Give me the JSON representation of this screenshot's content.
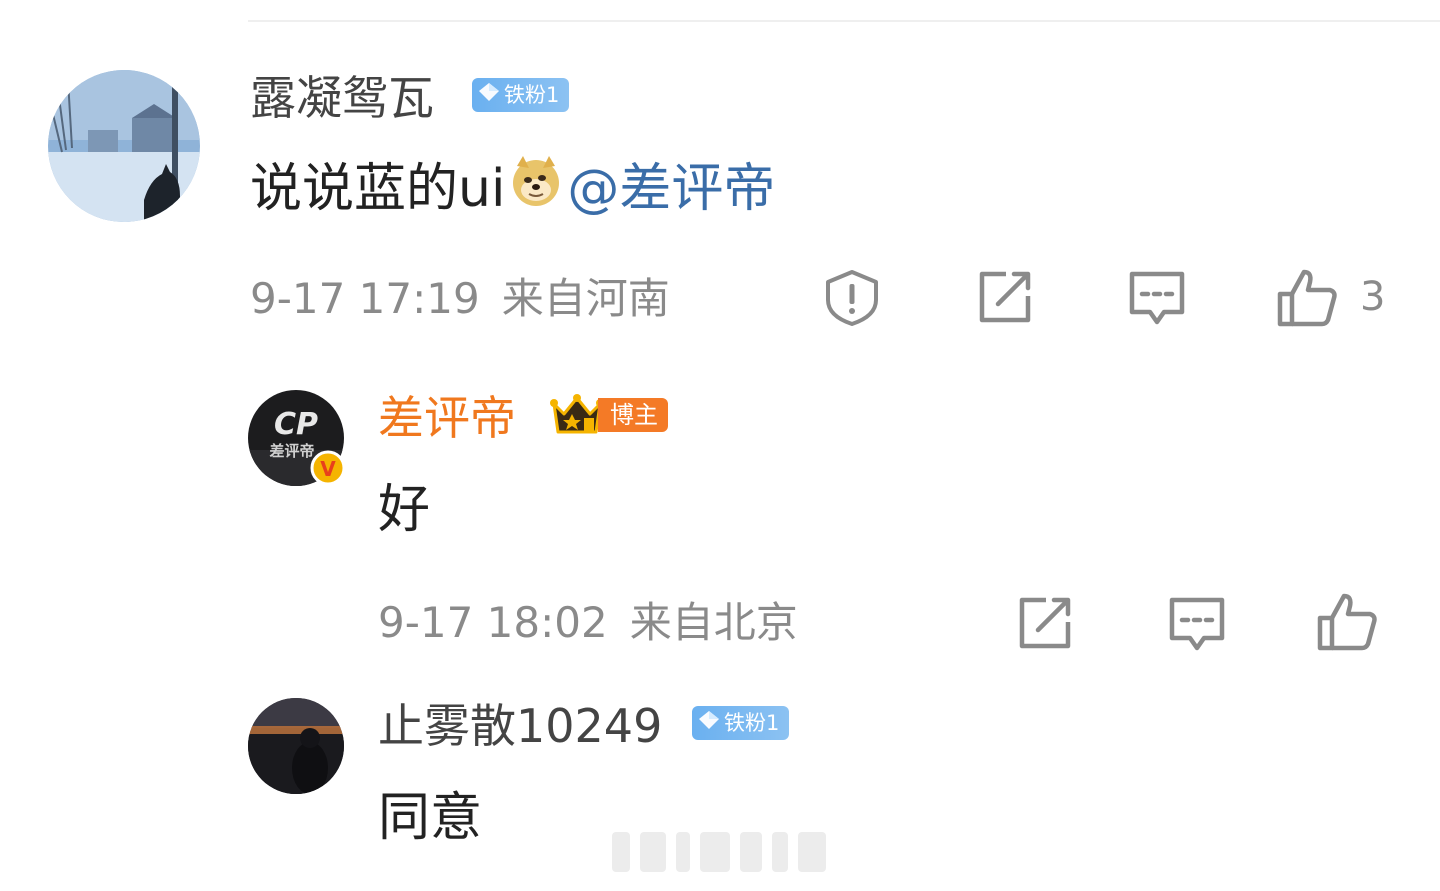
{
  "comments": [
    {
      "username": "露凝鸳瓦",
      "badge": "铁粉1",
      "text_parts": [
        "说说蓝的ui"
      ],
      "emoji": "doge-emoji",
      "mention": "@差评帝",
      "time": "9-17 17:19",
      "location": "来自河南",
      "like_count": "3"
    },
    {
      "username": "差评帝",
      "badge": "博主",
      "text": "好",
      "time": "9-17 18:02",
      "location": "来自北京",
      "verified_mark": "V"
    },
    {
      "username": "止雾散10249",
      "badge": "铁粉1",
      "text": "同意"
    }
  ],
  "icons": {
    "report": "shield-alert-icon",
    "share": "share-icon",
    "reply": "comment-icon",
    "like": "thumbs-up-icon"
  },
  "colors": {
    "mention": "#3a6da8",
    "host_name": "#f0781e",
    "fan_badge": "#6ab0f0",
    "meta_text": "#8a8a8a"
  }
}
